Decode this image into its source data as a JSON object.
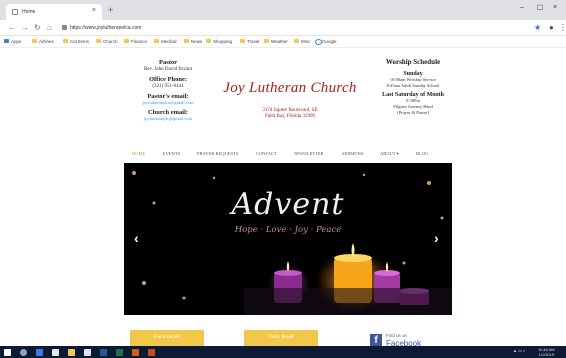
{
  "browser": {
    "tab_title": "Home",
    "url": "https://www.joylutheranelca.com",
    "bookmarks": [
      "Apps",
      "Airlines",
      "Cal Items",
      "Church",
      "Finance",
      "Medical",
      "News",
      "Shopping",
      "Travel",
      "Weather",
      "Misc",
      "Google"
    ]
  },
  "site": {
    "left": {
      "pastor_heading": "Pastor",
      "pastor_name": "Rev. John David Bryant",
      "office_phone_heading": "Office Phone:",
      "office_phone": "(321) 951-0444",
      "pastor_email_heading": "Pastor's email:",
      "pastor_email": "joylutheranelca@gmail.com",
      "church_email_heading": "Church email:",
      "church_email": "joylutheranjlc@gmail.com"
    },
    "church_name": "Joy Lutheran Church",
    "address_line1": "3174 Jupiter Boulevard, SE",
    "address_line2": "Palm Bay, Florida 32909",
    "right": {
      "schedule_heading": "Worship Schedule",
      "sunday_heading": "Sunday",
      "sunday_line1": "10:00am  Worship Service",
      "sunday_line2": "8:45am  Adult Sunday School",
      "last_sat_heading": "Last Saturday of Month",
      "last_sat_time": "5:30Pm",
      "last_sat_line1": "Pilgrim Journey Band",
      "last_sat_line2": "[Prayer & Praise]"
    },
    "nav": [
      "HOME",
      "EVENTS",
      "PRAYER REQUESTS",
      "CONTACT",
      "NEWSLETTER",
      "SERMONS",
      "ABOUT ▾",
      "BLOG"
    ],
    "banner": {
      "title": "Advent",
      "subtitle": "Hope · Love · Joy · Peace",
      "prev": "‹",
      "next": "›"
    },
    "buttons": {
      "event_details": "Event Details",
      "daily_bread": "Daily Bread"
    },
    "facebook": {
      "logo": "f",
      "find_us": "Find us on",
      "label": "Facebook"
    }
  },
  "taskbar": {
    "time": "11:46 AM",
    "date": "1/1/2019"
  }
}
